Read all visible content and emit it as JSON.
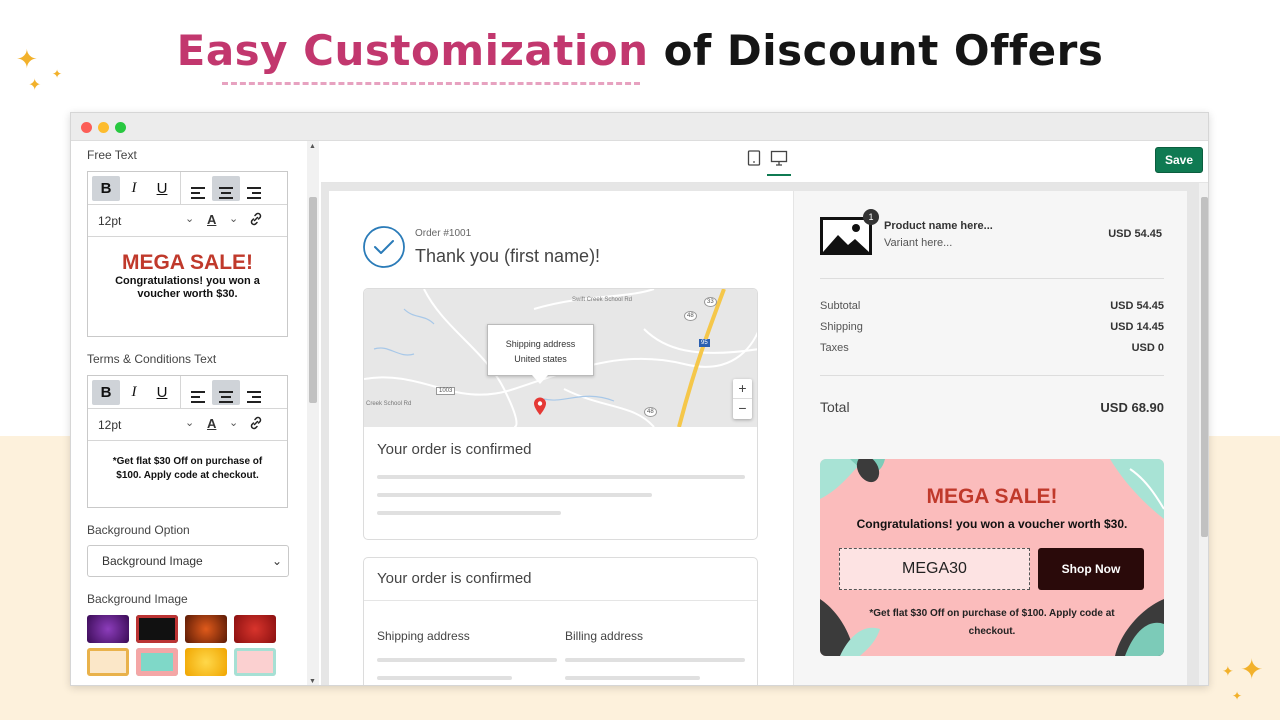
{
  "hero": {
    "highlight": "Easy Customization",
    "rest": "of Discount Offers"
  },
  "left_panel": {
    "free_text_label": "Free Text",
    "font_size_1": "12pt",
    "preview_title": "MEGA SALE!",
    "preview_body": "Congratulations! you won a voucher worth $30.",
    "terms_label": "Terms & Conditions Text",
    "font_size_2": "12pt",
    "terms_text": "*Get flat $30 Off on purchase of $100. Apply code at checkout.",
    "bg_option_label": "Background Option",
    "bg_option_value": "Background Image",
    "bg_image_label": "Background Image"
  },
  "toolbar": {
    "save_label": "Save"
  },
  "order": {
    "number": "Order #1001",
    "thank_you": "Thank you (first name)!",
    "map_tooltip_line1": "Shipping address",
    "map_tooltip_line2": "United states",
    "map_roads": {
      "road1": "Swift Creek School Rd",
      "road2": "Creek School Rd",
      "road3": "1003",
      "hw1": "33",
      "hw2": "48",
      "hw3": "95",
      "hw4": "48"
    },
    "confirmed_1": "Your order is confirmed",
    "confirmed_2": "Your order is confirmed",
    "shipping_address": "Shipping address",
    "billing_address": "Billing address"
  },
  "summary": {
    "product_name": "Product name here...",
    "variant": "Variant here...",
    "product_price": "USD 54.45",
    "qty_badge": "1",
    "subtotal_label": "Subtotal",
    "subtotal": "USD 54.45",
    "shipping_label": "Shipping",
    "shipping": "USD 14.45",
    "taxes_label": "Taxes",
    "taxes": "USD 0",
    "total_label": "Total",
    "total": "USD 68.90"
  },
  "promo": {
    "title": "MEGA SALE!",
    "subtitle": "Congratulations! you won a voucher worth $30.",
    "code": "MEGA30",
    "button": "Shop Now",
    "terms": "*Get flat $30 Off on purchase of $100. Apply code at checkout."
  },
  "colors": {
    "accent": "#c2376e",
    "save": "#0f7a52",
    "promo_bg": "#fbbcbc",
    "promo_title": "#c0392b",
    "shop_btn": "#2a0a0a"
  },
  "icons": [
    "bold-icon",
    "italic-icon",
    "underline-icon",
    "align-left-icon",
    "align-center-icon",
    "align-right-icon",
    "font-color-icon",
    "link-icon",
    "tablet-icon",
    "desktop-icon",
    "check-circle-icon",
    "map-pin-icon",
    "zoom-in-icon",
    "zoom-out-icon",
    "image-placeholder-icon"
  ]
}
